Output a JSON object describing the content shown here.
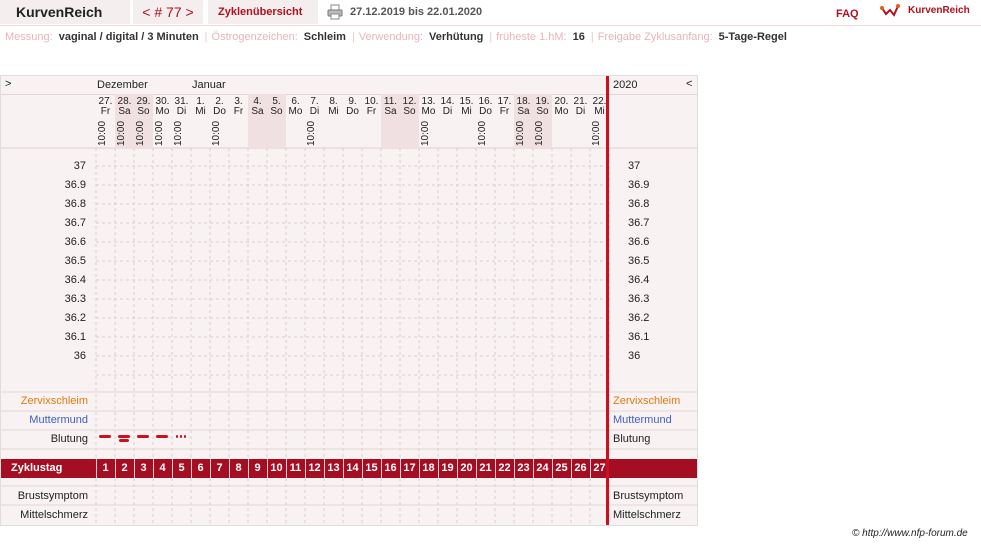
{
  "topbar": {
    "brand": "KurvenReich",
    "prev": "<",
    "cycle": "# 77",
    "next": ">",
    "overview": "Zyklenübersicht",
    "date_range": "27.12.2019 bis 22.01.2020",
    "faq": "FAQ",
    "logo_text": "KurvenReich"
  },
  "meta": [
    {
      "label": "Messung:",
      "value": "vaginal / digital / 3 Minuten"
    },
    {
      "label": "Östrogenzeichen:",
      "value": "Schleim"
    },
    {
      "label": "Verwendung:",
      "value": "Verhütung"
    },
    {
      "label": "früheste 1.hM:",
      "value": "16"
    },
    {
      "label": "Freigabe Zyklusanfang:",
      "value": "5-Tage-Regel"
    }
  ],
  "chart": {
    "nav_left": ">",
    "nav_right": "<",
    "months": [
      "Dezember",
      "Januar"
    ],
    "year": "2020",
    "days": [
      {
        "d": "27.",
        "w": "Fr",
        "t": "10:00",
        "we": false
      },
      {
        "d": "28.",
        "w": "Sa",
        "t": "10:00",
        "we": true
      },
      {
        "d": "29.",
        "w": "So",
        "t": "10:00",
        "we": true
      },
      {
        "d": "30.",
        "w": "Mo",
        "t": "10:00",
        "we": false
      },
      {
        "d": "31.",
        "w": "Di",
        "t": "10:00",
        "we": false
      },
      {
        "d": "1.",
        "w": "Mi",
        "t": "",
        "we": false
      },
      {
        "d": "2.",
        "w": "Do",
        "t": "10:00",
        "we": false
      },
      {
        "d": "3.",
        "w": "Fr",
        "t": "",
        "we": false
      },
      {
        "d": "4.",
        "w": "Sa",
        "t": "",
        "we": true
      },
      {
        "d": "5.",
        "w": "So",
        "t": "",
        "we": true
      },
      {
        "d": "6.",
        "w": "Mo",
        "t": "",
        "we": false
      },
      {
        "d": "7.",
        "w": "Di",
        "t": "10:00",
        "we": false
      },
      {
        "d": "8.",
        "w": "Mi",
        "t": "",
        "we": false
      },
      {
        "d": "9.",
        "w": "Do",
        "t": "",
        "we": false
      },
      {
        "d": "10.",
        "w": "Fr",
        "t": "",
        "we": false
      },
      {
        "d": "11.",
        "w": "Sa",
        "t": "",
        "we": true
      },
      {
        "d": "12.",
        "w": "So",
        "t": "",
        "we": true
      },
      {
        "d": "13.",
        "w": "Mo",
        "t": "10:00",
        "we": false
      },
      {
        "d": "14.",
        "w": "Di",
        "t": "",
        "we": false
      },
      {
        "d": "15.",
        "w": "Mi",
        "t": "",
        "we": false
      },
      {
        "d": "16.",
        "w": "Do",
        "t": "10:00",
        "we": false
      },
      {
        "d": "17.",
        "w": "Fr",
        "t": "",
        "we": false
      },
      {
        "d": "18.",
        "w": "Sa",
        "t": "10:00",
        "we": true
      },
      {
        "d": "19.",
        "w": "So",
        "t": "10:00",
        "we": true
      },
      {
        "d": "20.",
        "w": "Mo",
        "t": "",
        "we": false
      },
      {
        "d": "21.",
        "w": "Di",
        "t": "",
        "we": false
      },
      {
        "d": "22.",
        "w": "Mi",
        "t": "10:00",
        "we": false
      }
    ],
    "temps": [
      "37",
      "36.9",
      "36.8",
      "36.7",
      "36.6",
      "36.5",
      "36.4",
      "36.3",
      "36.2",
      "36.1",
      "36"
    ],
    "rows": {
      "cervix": "Zervixschleim",
      "muttermund": "Muttermund",
      "blutung": "Blutung",
      "zyklustag": "Zyklustag",
      "brust": "Brustsymptom",
      "mittelschmerz": "Mittelschmerz"
    },
    "bleeding": [
      "stark",
      "stark",
      "stark",
      "stark",
      "schmierblutung"
    ],
    "cycle_days": [
      "1",
      "2",
      "3",
      "4",
      "5",
      "6",
      "7",
      "8",
      "9",
      "10",
      "11",
      "12",
      "13",
      "14",
      "15",
      "16",
      "17",
      "18",
      "19",
      "20",
      "21",
      "22",
      "23",
      "24",
      "25",
      "26",
      "27"
    ],
    "colors": {
      "accent": "#a50e22",
      "cervix": "#e07a10",
      "muttermund": "#4060c0",
      "line": "#cc1020"
    }
  },
  "copyright": "© http://www.nfp-forum.de"
}
